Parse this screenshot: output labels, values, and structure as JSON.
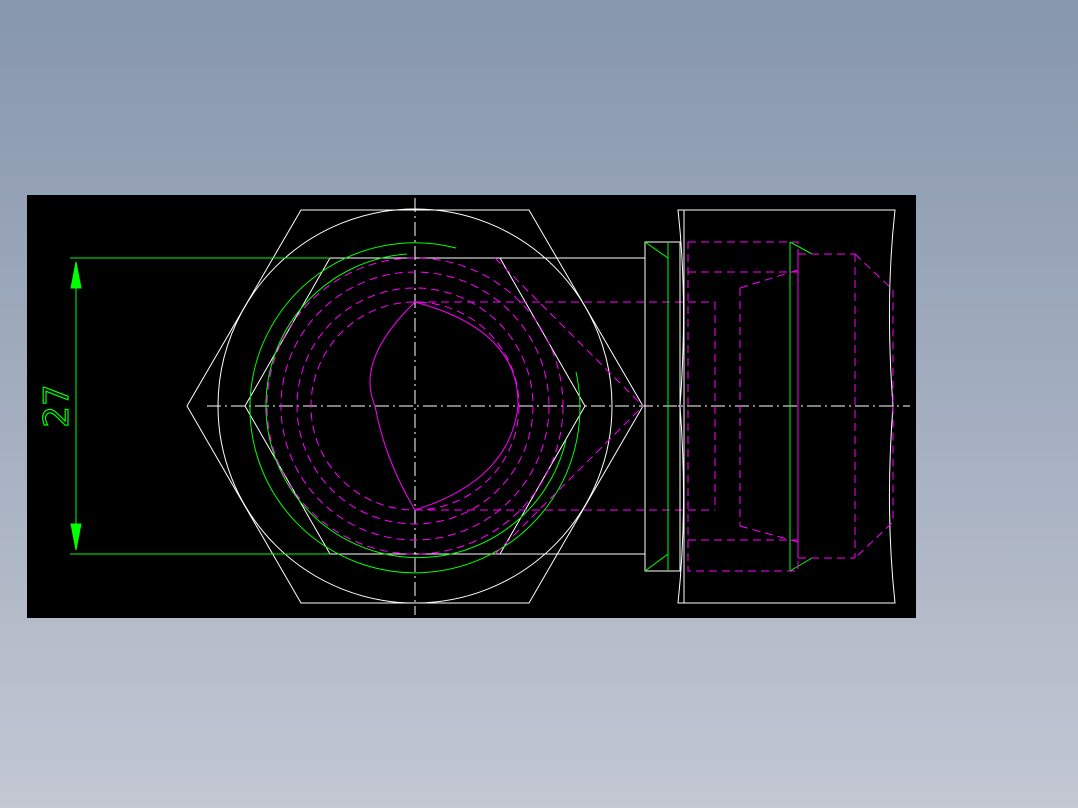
{
  "drawing": {
    "dimension_value": "27"
  },
  "colors": {
    "background_top": "#8797ad",
    "background_bottom": "#c3c8d3",
    "canvas": "#000000",
    "outline": "#ffffff",
    "hidden_lines": "#ff00ff",
    "dimension": "#00ff00"
  }
}
